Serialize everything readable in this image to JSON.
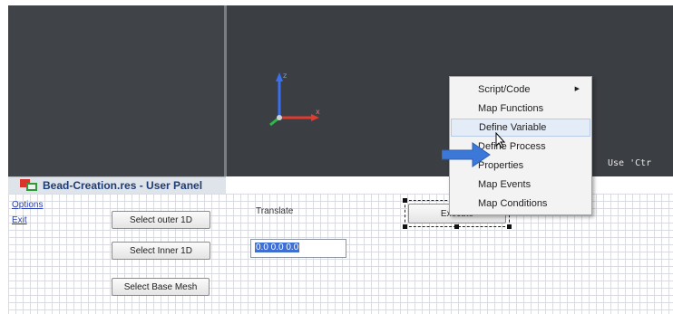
{
  "viewport": {
    "hint": "Use 'Ctr"
  },
  "axis_labels": {
    "z": "z",
    "x": "x"
  },
  "user_panel": {
    "title": "Bead-Creation.res - User Panel",
    "links": {
      "options": "Options",
      "exit": "Exit"
    },
    "buttons": {
      "select_outer": "Select outer 1D",
      "select_inner": "Select Inner 1D",
      "select_base_mesh": "Select Base Mesh",
      "execute": "Execute"
    },
    "translate_label": "Translate",
    "translate_value": "0.0 0.0 0.0"
  },
  "context_menu": {
    "items": [
      {
        "label": "Script/Code",
        "submenu": true
      },
      {
        "label": "Map Functions"
      },
      {
        "label": "Define Variable",
        "highlighted": true
      },
      {
        "label": "Define Process"
      },
      {
        "label": "Properties"
      },
      {
        "label": "Map Events"
      },
      {
        "label": "Map Conditions"
      }
    ]
  },
  "colors": {
    "viewport_bg": "#3b3e43",
    "panel_title": "#1c3c78",
    "link": "#2a3fb4",
    "annotation_arrow": "#3c78d8",
    "axis_z": "#3a6ff0",
    "axis_x": "#e03b2f",
    "axis_y": "#2fb84a"
  },
  "icons": {
    "panel": "user-panel-icon",
    "submenu": "chevron-right-icon",
    "cursor": "mouse-pointer-icon",
    "annotation": "arrow-right-icon"
  }
}
